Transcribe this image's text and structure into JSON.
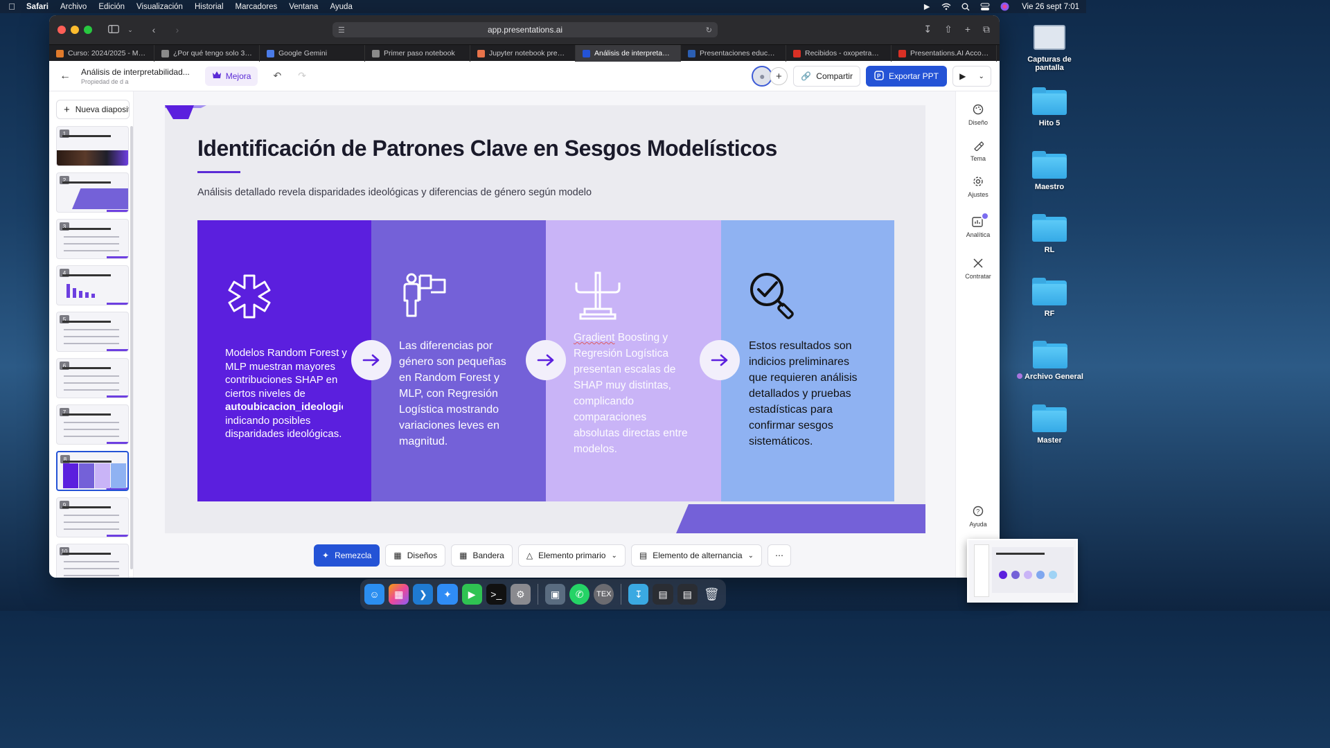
{
  "menubar": {
    "app": "Safari",
    "items": [
      "Archivo",
      "Edición",
      "Visualización",
      "Historial",
      "Marcadores",
      "Ventana",
      "Ayuda"
    ],
    "clock": "Vie 26 sept 7:01"
  },
  "browser": {
    "url": "app.presentations.ai",
    "tabs": [
      {
        "label": "Curso: 2024/2025 - Má...",
        "color": "#e07a2b"
      },
      {
        "label": "¿Por qué tengo solo 30...",
        "color": "#8a8a8a"
      },
      {
        "label": "Google Gemini",
        "color": "#4a7be8"
      },
      {
        "label": "Primer paso notebook",
        "color": "#8a8a8a"
      },
      {
        "label": "Jupyter notebook prese...",
        "color": "#e8734a"
      },
      {
        "label": "Análisis de interpretabili...",
        "color": "#2453d6",
        "active": true
      },
      {
        "label": "Presentaciones educativ...",
        "color": "#2b5fb3"
      },
      {
        "label": "Recibidos - oxopetra@g...",
        "color": "#d93025"
      },
      {
        "label": "Presentations.AI Accou...",
        "color": "#d93025"
      }
    ]
  },
  "header": {
    "doc_title": "Análisis de interpretabilidad...",
    "doc_sub": "Propiedad de d a",
    "mejora": "Mejora",
    "share": "Compartir",
    "export": "Exportar PPT"
  },
  "sidebar": {
    "new_slide": "Nueva diapositiva",
    "slides": [
      "1",
      "2",
      "3",
      "4",
      "5",
      "6",
      "7",
      "8",
      "9",
      "10"
    ],
    "active_slide": 8
  },
  "slide": {
    "title": "Identificación de Patrones Clave en Sesgos Modelísticos",
    "subtitle": "Análisis detallado revela disparidades ideológicas y diferencias de género según modelo",
    "panels": [
      {
        "icon": "asterisk-icon",
        "text_before": "Modelos Random Forest y MLP muestran mayores contribuciones SHAP en ciertos niveles de",
        "keyword": "autoubicacion_ideologica",
        "text_after": "indicando posibles disparidades ideológicas.",
        "color": "#5b1fde"
      },
      {
        "icon": "person-flag-icon",
        "text": "Las diferencias por género son pequeñas en Random Forest y MLP, con Regresión Logística mostrando variaciones leves en magnitud.",
        "color": "#7461d8"
      },
      {
        "icon": "balance-scale-icon",
        "keyword": "Gradient",
        "text": " Boosting y Regresión Logística presentan escalas de SHAP muy distintas, complicando comparaciones absolutas directas entre modelos.",
        "color": "#c9b4f7"
      },
      {
        "icon": "magnifier-check-icon",
        "text": "Estos resultados son indicios preliminares que requieren análisis detallados y pruebas estadísticas para confirmar sesgos sistemáticos.",
        "color": "#8fb2f2"
      }
    ]
  },
  "rightpanel": {
    "items": [
      "Diseño",
      "Tema",
      "Ajustes",
      "Analítica",
      "Contratar"
    ],
    "help": "Ayuda"
  },
  "toolbar": {
    "remix": "Remezcla",
    "designs": "Diseños",
    "flag": "Bandera",
    "primary": "Elemento primario",
    "alternate": "Elemento de alternancia"
  },
  "desktop": {
    "items": [
      "Capturas de pantalla",
      "Hito 5",
      "Maestro",
      "RL",
      "RF",
      "Archivo General",
      "Master"
    ]
  }
}
